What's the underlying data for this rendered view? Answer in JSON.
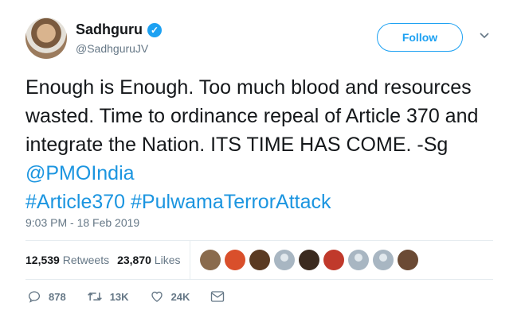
{
  "author": {
    "name": "Sadhguru",
    "handle": "@SadhguruJV",
    "follow_label": "Follow"
  },
  "tweet": {
    "text": "Enough is Enough. Too much blood and resources wasted. Time to ordinance repeal of Article 370 and integrate the Nation. ITS TIME HAS COME. -Sg ",
    "mention": "@PMOIndia",
    "hashtag1": "#Article370",
    "hashtag2": "#PulwamaTerrorAttack",
    "timestamp": "9:03 PM - 18 Feb 2019"
  },
  "stats": {
    "retweets_count": "12,539",
    "retweets_label": "Retweets",
    "likes_count": "23,870",
    "likes_label": "Likes"
  },
  "likers": [
    {
      "color": "#8a6b4d"
    },
    {
      "color": "#d94f2b"
    },
    {
      "color": "#5a3a22"
    },
    {
      "color": "#a8b6c2"
    },
    {
      "color": "#3b2a1f"
    },
    {
      "color": "#c0392b"
    },
    {
      "color": "#a8b6c2"
    },
    {
      "color": "#a8b6c2"
    },
    {
      "color": "#6b4a34"
    }
  ],
  "actions": {
    "replies": "878",
    "retweets": "13K",
    "likes": "24K"
  },
  "colors": {
    "accent": "#1da1f2",
    "link": "#1b95e0",
    "muted": "#657786"
  }
}
